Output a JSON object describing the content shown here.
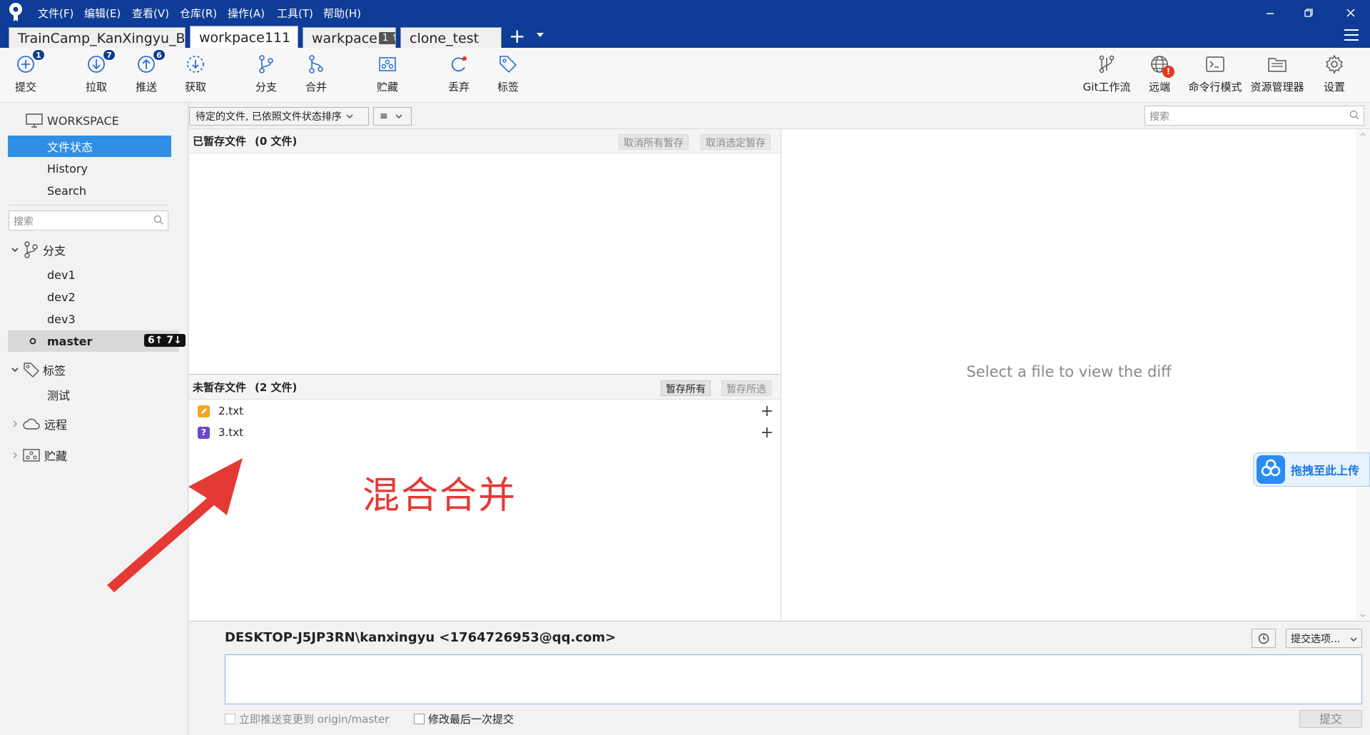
{
  "menu": [
    "文件(F)",
    "编辑(E)",
    "查看(V)",
    "仓库(R)",
    "操作(A)",
    "工具(T)",
    "帮助(H)"
  ],
  "tabs": [
    {
      "label": "TrainCamp_KanXingyu_B...",
      "close": "",
      "badge": ""
    },
    {
      "label": "workpace111",
      "close": "✕",
      "badge": ""
    },
    {
      "label": "warkpace",
      "close": "",
      "badge": "1 ↑"
    },
    {
      "label": "clone_test",
      "close": "",
      "badge": ""
    }
  ],
  "toolbar": {
    "commit": {
      "label": "提交",
      "badge": "1"
    },
    "pull": {
      "label": "拉取",
      "badge": "7"
    },
    "push": {
      "label": "推送",
      "badge": "6"
    },
    "fetch": {
      "label": "获取"
    },
    "branch": {
      "label": "分支"
    },
    "merge": {
      "label": "合并"
    },
    "stash": {
      "label": "贮藏"
    },
    "discard": {
      "label": "丢弃"
    },
    "tag": {
      "label": "标签"
    },
    "gitflow": {
      "label": "Git工作流"
    },
    "remote": {
      "label": "远端",
      "badge": "!"
    },
    "terminal": {
      "label": "命令行模式"
    },
    "explorer": {
      "label": "资源管理器"
    },
    "settings": {
      "label": "设置"
    }
  },
  "sidebar": {
    "workspace": "WORKSPACE",
    "nav": [
      "文件状态",
      "History",
      "Search"
    ],
    "search_placeholder": "搜索",
    "branches_label": "分支",
    "branches": [
      "dev1",
      "dev2",
      "dev3"
    ],
    "current_branch": "master",
    "current_branch_status": "6↑ 7↓",
    "tags_label": "标签",
    "tags": [
      "测试"
    ],
    "remotes_label": "远程",
    "stashes_label": "贮藏"
  },
  "filter": {
    "sort_label": "待定的文件, 已依照文件状态排序",
    "view_label": "≡",
    "search_placeholder": "搜索"
  },
  "staged": {
    "title": "已暂存文件",
    "count": "(0 文件)",
    "unstage_all": "取消所有暂存",
    "unstage_selected": "取消选定暂存"
  },
  "unstaged": {
    "title": "未暂存文件",
    "count": "(2 文件)",
    "stage_all": "暂存所有",
    "stage_selected": "暂存所选",
    "files": [
      {
        "name": "2.txt",
        "status": "modified",
        "color": "#f5a623"
      },
      {
        "name": "3.txt",
        "status": "untracked",
        "color": "#6b48c8"
      }
    ]
  },
  "diff": {
    "placeholder": "Select a file to view the diff"
  },
  "commit": {
    "author": "DESKTOP-J5JP3RN\\kanxingyu <1764726953@qq.com>",
    "options_label": "提交选项...",
    "push_immediately": "立即推送变更到 origin/master",
    "amend": "修改最后一次提交",
    "submit": "提交"
  },
  "upload_widget": {
    "label": "拖拽至此上传"
  },
  "annotation": "混合合并",
  "colors": {
    "titlebar": "#0e3c96",
    "selection": "#2f8fe5",
    "annotation": "#e53935"
  }
}
